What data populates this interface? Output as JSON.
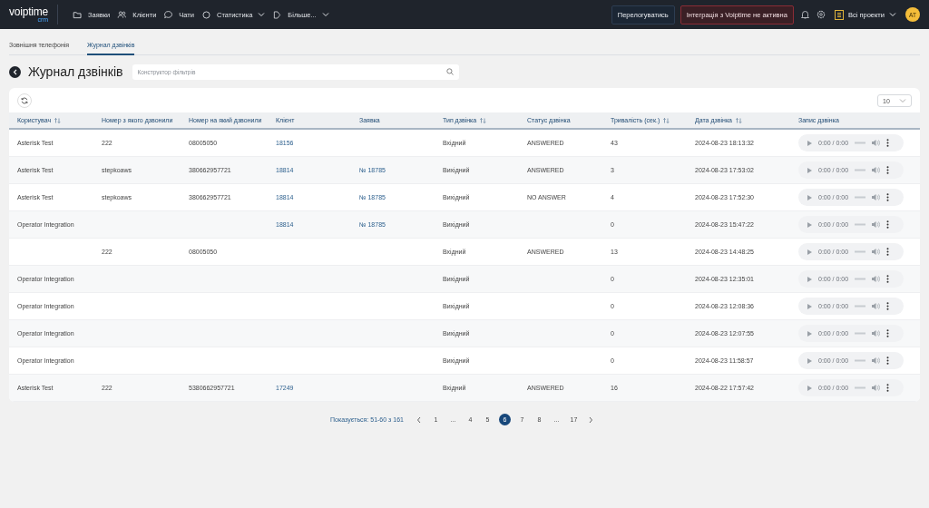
{
  "header": {
    "logo": {
      "name": "voiptime",
      "sub": "crm"
    },
    "nav": [
      {
        "label": "Заявки",
        "has_menu": false
      },
      {
        "label": "Клієнти",
        "has_menu": false
      },
      {
        "label": "Чати",
        "has_menu": false
      },
      {
        "label": "Статистика",
        "has_menu": true
      },
      {
        "label": "Більше...",
        "has_menu": true
      }
    ],
    "login_button": "Перелогуватись",
    "integration_alert": "Інтеграція з Voiptime не активна",
    "project": "Всі проекти",
    "avatar": "AT"
  },
  "tabs": [
    {
      "label": "Зовнішня телефонія",
      "selected": false
    },
    {
      "label": "Журнал дзвінків",
      "selected": true
    }
  ],
  "page_title": "Журнал дзвінків",
  "filter": {
    "placeholder": "Конструктор фільтрів"
  },
  "page_size": "10",
  "table": {
    "columns": [
      {
        "label": "Користувач",
        "sortable": true
      },
      {
        "label": "Номер з якого дзвонили",
        "sortable": false
      },
      {
        "label": "Номер на який дзвонили",
        "sortable": false
      },
      {
        "label": "Клієнт",
        "sortable": false
      },
      {
        "label": "Заявка",
        "sortable": false
      },
      {
        "label": "Тип дзвінка",
        "sortable": true
      },
      {
        "label": "Статус дзвінка",
        "sortable": false
      },
      {
        "label": "Тривалість (сек.)",
        "sortable": true
      },
      {
        "label": "Дата дзвінка",
        "sortable": true
      },
      {
        "label": "Запис дзвінка",
        "sortable": false
      }
    ],
    "rows": [
      {
        "user": "Asterisk Test",
        "from": "222",
        "to": "08005050",
        "client": "18156",
        "type": "Вхідний",
        "status": "ANSWERED",
        "duration": "43",
        "date": "2024-08-23 18:13:32",
        "recording": "0:00 / 0:00"
      },
      {
        "user": "Asterisk Test",
        "from": "stepkoaws",
        "to": "380662957721",
        "client": "18814",
        "request": "№ 18785",
        "type": "Вихідний",
        "status": "ANSWERED",
        "duration": "3",
        "date": "2024-08-23 17:53:02",
        "recording": "0:00 / 0:00"
      },
      {
        "user": "Asterisk Test",
        "from": "stepkoaws",
        "to": "380662957721",
        "client": "18814",
        "request": "№ 18785",
        "type": "Вихідний",
        "status": "NO ANSWER",
        "duration": "4",
        "date": "2024-08-23 17:52:30",
        "recording": "0:00 / 0:00"
      },
      {
        "user": "Operator Integration",
        "client": "18814",
        "request": "№ 18785",
        "type": "Вихідний",
        "duration": "0",
        "date": "2024-08-23 15:47:22",
        "recording": "0:00 / 0:00"
      },
      {
        "from": "222",
        "to": "08005050",
        "type": "Вхідний",
        "status": "ANSWERED",
        "duration": "13",
        "date": "2024-08-23 14:48:25",
        "recording": "0:00 / 0:00"
      },
      {
        "user": "Operator Integration",
        "type": "Вихідний",
        "duration": "0",
        "date": "2024-08-23 12:35:01",
        "recording": "0:00 / 0:00"
      },
      {
        "user": "Operator Integration",
        "type": "Вихідний",
        "duration": "0",
        "date": "2024-08-23 12:08:36",
        "recording": "0:00 / 0:00"
      },
      {
        "user": "Operator Integration",
        "type": "Вихідний",
        "duration": "0",
        "date": "2024-08-23 12:07:55",
        "recording": "0:00 / 0:00"
      },
      {
        "user": "Operator Integration",
        "type": "Вихідний",
        "duration": "0",
        "date": "2024-08-23 11:58:57",
        "recording": "0:00 / 0:00"
      },
      {
        "user": "Asterisk Test",
        "from": "222",
        "to": "5380662957721",
        "client": "17249",
        "type": "Вхідний",
        "status": "ANSWERED",
        "duration": "16",
        "date": "2024-08-22 17:57:42",
        "recording": "0:00 / 0:00"
      }
    ]
  },
  "pagination": {
    "summary": "Показується: 51-60 з 161",
    "pages": [
      {
        "kind": "prev"
      },
      {
        "kind": "page",
        "label": "1",
        "selected": false
      },
      {
        "kind": "gap",
        "label": "..."
      },
      {
        "kind": "page",
        "label": "4",
        "selected": false
      },
      {
        "kind": "page",
        "label": "5",
        "selected": false
      },
      {
        "kind": "page",
        "label": "6",
        "selected": true
      },
      {
        "kind": "page",
        "label": "7",
        "selected": false
      },
      {
        "kind": "page",
        "label": "8",
        "selected": false
      },
      {
        "kind": "gap",
        "label": "..."
      },
      {
        "kind": "page",
        "label": "17",
        "selected": false
      },
      {
        "kind": "next"
      }
    ]
  }
}
